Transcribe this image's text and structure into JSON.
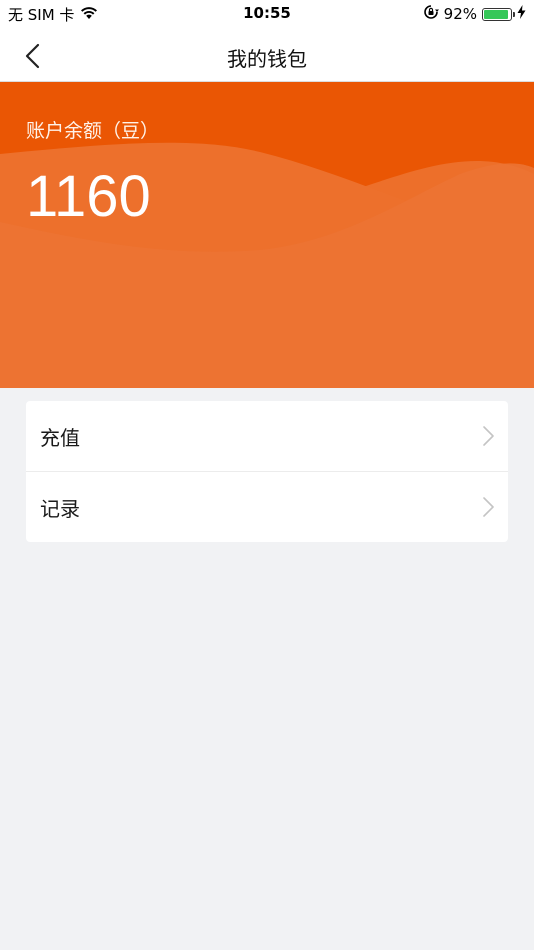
{
  "status_bar": {
    "carrier": "无 SIM 卡",
    "wifi_icon": "wifi-icon",
    "time": "10:55",
    "orientation_lock_icon": "orientation-lock-icon",
    "battery_percent": "92%",
    "battery_level": 0.92,
    "battery_color": "#35c759",
    "charging_icon": "bolt-icon"
  },
  "nav": {
    "back_icon": "chevron-left-icon",
    "title": "我的钱包"
  },
  "balance": {
    "label": "账户余额（豆）",
    "value": "1160",
    "accent_color": "#ed6f2a"
  },
  "menu": {
    "items": [
      {
        "label": "充值",
        "icon": "chevron-right-icon"
      },
      {
        "label": "记录",
        "icon": "chevron-right-icon"
      }
    ]
  }
}
